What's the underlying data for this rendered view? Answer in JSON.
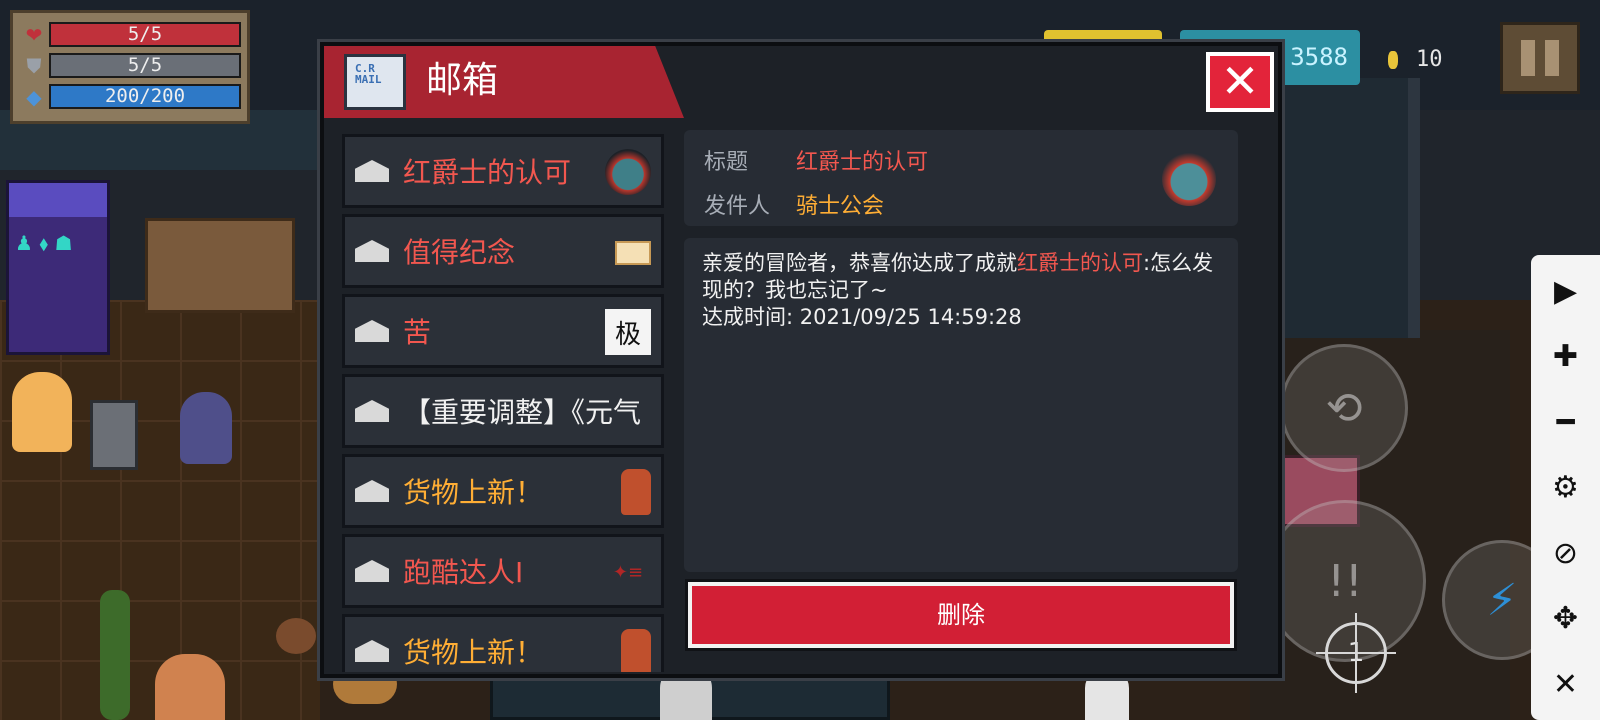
{
  "hud": {
    "hp": {
      "text": "5/5",
      "fraction": 1.0,
      "color": "#c0313b",
      "icon": "heart-icon"
    },
    "armor": {
      "text": "5/5",
      "fraction": 1.0,
      "color": "#6a6f77",
      "icon": "shield-icon"
    },
    "energy": {
      "text": "200/200",
      "fraction": 1.0,
      "color": "#2e79c7",
      "icon": "diamond-icon"
    },
    "gems": "3588",
    "coins": "10"
  },
  "mailbox": {
    "title": "邮箱",
    "envelope_label": "C.R MAIL",
    "close_label": "✕",
    "list": [
      {
        "subject": "红爵士的认可",
        "color": "red",
        "thumb": "helm-icon"
      },
      {
        "subject": "值得纪念",
        "color": "red",
        "thumb": "card-icon"
      },
      {
        "subject": "苦",
        "color": "red",
        "thumb": "text-tile-icon",
        "thumb_text": "极"
      },
      {
        "subject": "【重要调整】《元气",
        "color": "white",
        "thumb": ""
      },
      {
        "subject": "货物上新！",
        "color": "orange",
        "thumb": "character-icon"
      },
      {
        "subject": "跑酷达人I",
        "color": "red",
        "thumb": "runner-icon"
      },
      {
        "subject": "货物上新！",
        "color": "orange",
        "thumb": "character-icon"
      }
    ],
    "detail": {
      "title_label": "标题",
      "title_value": "红爵士的认可",
      "sender_label": "发件人",
      "sender_value": "骑士公会",
      "body_pre": "亲爱的冒险者，恭喜你达成了成就",
      "body_highlight": "红爵士的认可",
      "body_post": ":怎么发现的？我也忘记了~",
      "body_time": "达成时间: 2021/09/25 14:59:28",
      "delete_label": "删除"
    },
    "colors": {
      "accent_red": "#d21f35",
      "title_red": "#f2574f",
      "sender_orange": "#ffae35"
    }
  },
  "controls": {
    "crosshair_number": "1"
  },
  "overlay_toolbar": [
    "play-icon",
    "zoom-in-icon",
    "zoom-out-icon",
    "gear-icon",
    "hide-icon",
    "move-icon",
    "close-icon"
  ]
}
